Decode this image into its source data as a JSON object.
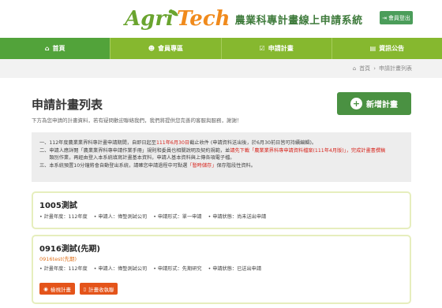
{
  "header": {
    "logo_ag": "Agri",
    "logo_tech": "Tech",
    "site_title": "農業科專計畫線上申請系統",
    "logout_label": "會員登出"
  },
  "nav": {
    "items": [
      {
        "label": "首頁",
        "icon": "home-icon"
      },
      {
        "label": "會員專區",
        "icon": "user-icon"
      },
      {
        "label": "申請計畫",
        "icon": "checkbox-icon"
      },
      {
        "label": "資訊公告",
        "icon": "news-icon"
      }
    ]
  },
  "breadcrumb": {
    "home": "首頁",
    "sep": "›",
    "current": "申請計畫列表"
  },
  "page": {
    "title": "申請計畫列表",
    "description": "下方為您申請的計畫資料，若有疑問歡迎聯絡我們，我們將提供您完善的客服與服務，謝謝！",
    "add_button": "新增計畫",
    "add_icon": "+"
  },
  "notice": {
    "line1_a": "一、112年度農業業界科專計畫申請期間，自即日起至",
    "line1_red": "111年6月30日",
    "line1_b": "截止收件 (申請資料送出後，於6月30前日皆可持續編輯)。",
    "line2_a": "二、申請人應詳閱「農業業界科專申請作業手冊」規則和委員也相關說明及契約規範，並",
    "line2_link": "請先下載「農業業界科專申請資料檔案(111年4月版)」",
    "line2_red": "，完成計畫書撰稿",
    "line3": "　　類別作業，再經由登入本系統填寫計畫基本資料，申請人基本資料與上傳各項電子檔。",
    "line4_a": "三、本系統預置10分鐘將會自動登出系統，請確您申請過程中可點選",
    "line4_red": "「暫時儲存」",
    "line4_b": "保存階段性資料。"
  },
  "cards": [
    {
      "title": "1005測試",
      "subtitle": "",
      "meta": [
        "計畫年度：112年度",
        "申請人：偉墊測試公司",
        "申請形式：單一申請",
        "申請狀態：尚未送出申請"
      ]
    },
    {
      "title": "0916測試(先期)",
      "subtitle": "0916test(先期)",
      "meta": [
        "計畫年度：112年度",
        "申請人：偉墊測試公司",
        "申請形式：先期研究",
        "申請狀態：已送出申請"
      ],
      "view_label": "檢視計畫",
      "delete_label": "計畫收執聯"
    }
  ],
  "colors": {
    "nav_green": "#86b82f",
    "nav_active": "#52a33a",
    "action_orange": "#e4541a",
    "notice_red": "#d7261e",
    "link_blue": "#2b66b6"
  }
}
